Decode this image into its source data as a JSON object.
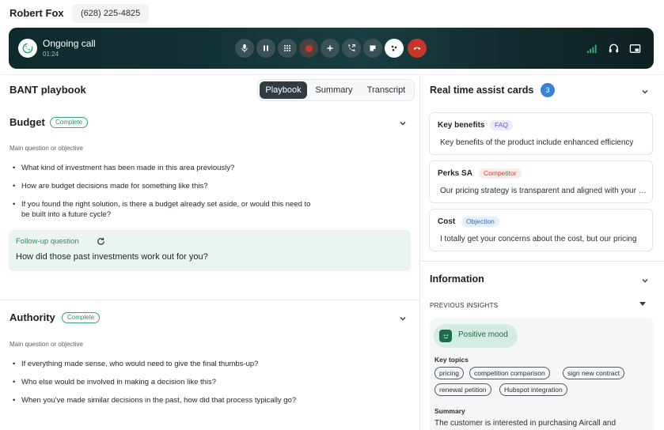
{
  "header": {
    "contact_name": "Robert Fox",
    "contact_phone": "(628) 225-4825"
  },
  "call": {
    "status": "Ongoing call",
    "timer": "01:24",
    "colors": {
      "bar": "#133135",
      "hangup": "#c6372a",
      "record": "#c63a2b",
      "signal": "#3fae6a"
    }
  },
  "playbook": {
    "title": "BANT playbook",
    "tabs": [
      {
        "label": "Playbook",
        "active": true
      },
      {
        "label": "Summary",
        "active": false
      },
      {
        "label": "Transcript",
        "active": false
      }
    ],
    "sections": [
      {
        "title": "Budget",
        "status": "Complete",
        "subhead": "Main question or objective",
        "questions": [
          "What kind of investment has been made in this area previously?",
          "How are budget decisions made for something like this?",
          "If you found the right solution, is there a budget already set aside, or would this need to be built into a future cycle?"
        ],
        "followup_label": "Follow-up question",
        "followup_text": "How did those past investments work out for you?"
      },
      {
        "title": "Authority",
        "status": "Complete",
        "subhead": "Main question or objective",
        "questions": [
          "If everything made sense, who would need to give the final thumbs-up?",
          "Who else would be involved in making a decision like this?",
          "When you've made similar decisions in the past, how did that process typically go?"
        ]
      }
    ]
  },
  "assist": {
    "title": "Real time assist cards",
    "count": "3",
    "cards": [
      {
        "title": "Key benefits",
        "tag": "FAQ",
        "text": "Key benefits of the product include enhanced efficiency"
      },
      {
        "title": "Perks SA",
        "tag": "Competitor",
        "text": "Our pricing strategy is transparent and aligned with your needs"
      },
      {
        "title": "Cost",
        "tag": "Objection",
        "text": "I totally get your concerns about the cost, but our pricing"
      }
    ]
  },
  "information": {
    "title": "Information",
    "previous_insights": "PREVIOUS INSIGHTS",
    "mood": "Positive mood",
    "key_topics_label": "Key topics",
    "topics": [
      "pricing",
      "competition comparison",
      "sign new contract",
      "renewal petition",
      "Hubspot integration"
    ],
    "summary_label": "Summary",
    "summary_text": "The customer is interested in purchasing Aircall and"
  }
}
